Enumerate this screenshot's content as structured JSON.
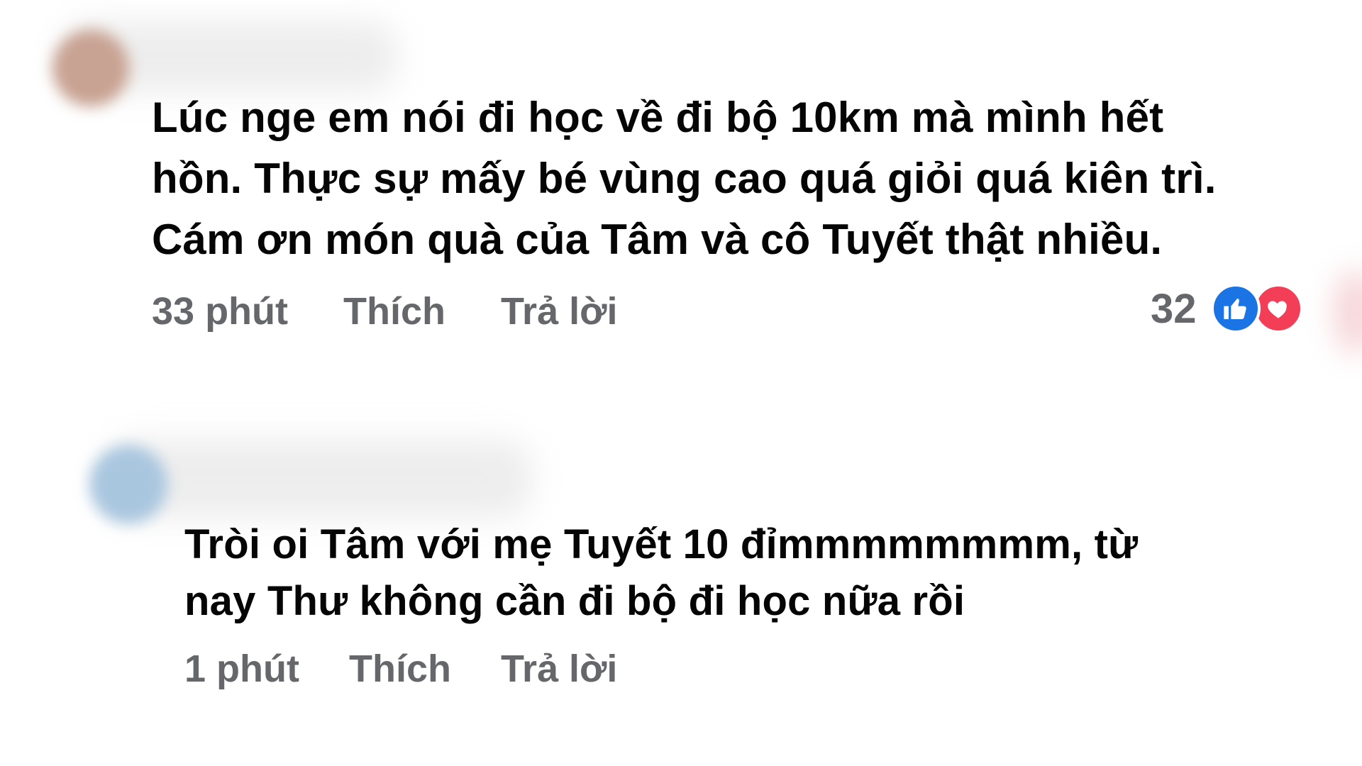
{
  "comments": [
    {
      "text_lines": [
        "Lúc nge em nói đi học về đi bộ 10km mà mình hết",
        "hồn. Thực sự mấy bé vùng cao quá giỏi quá kiên trì.",
        "Cám ơn món quà của Tâm và cô Tuyết thật nhiều."
      ],
      "time": "33 phút",
      "like_label": "Thích",
      "reply_label": "Trả lời",
      "reaction_count": "32",
      "reactions": [
        "like-icon",
        "love-icon"
      ]
    },
    {
      "text_lines": [
        "Tròi oi Tâm với mẹ Tuyết 10 đỉmmmmmmmm, từ",
        "nay Thư không cần đi bộ đi học nữa rồi"
      ],
      "time": "1 phút",
      "like_label": "Thích",
      "reply_label": "Trả lời"
    }
  ],
  "colors": {
    "text": "#050505",
    "meta": "#65676b",
    "like": "#1b74e4",
    "love": "#f33e58"
  }
}
